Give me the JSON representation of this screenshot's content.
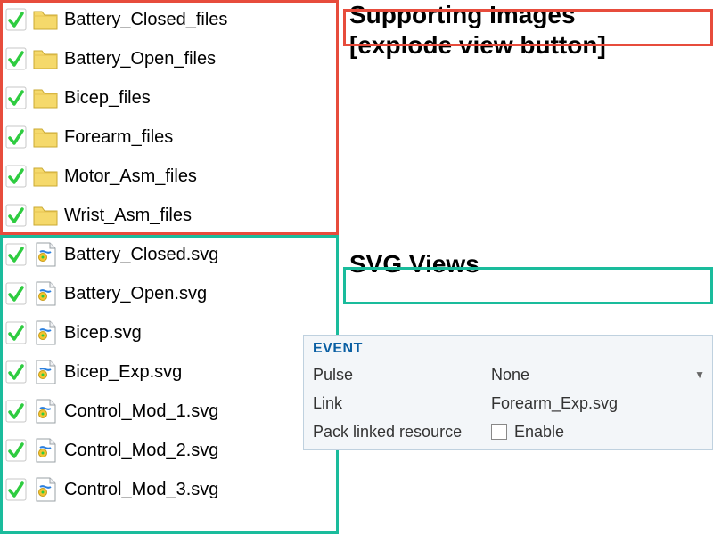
{
  "folders": [
    {
      "name": "Battery_Closed_files"
    },
    {
      "name": "Battery_Open_files"
    },
    {
      "name": "Bicep_files"
    },
    {
      "name": "Forearm_files"
    },
    {
      "name": "Motor_Asm_files"
    },
    {
      "name": "Wrist_Asm_files"
    }
  ],
  "svgs": [
    {
      "name": "Battery_Closed.svg"
    },
    {
      "name": "Battery_Open.svg"
    },
    {
      "name": "Bicep.svg"
    },
    {
      "name": "Bicep_Exp.svg"
    },
    {
      "name": "Control_Mod_1.svg"
    },
    {
      "name": "Control_Mod_2.svg"
    },
    {
      "name": "Control_Mod_3.svg"
    }
  ],
  "headings": {
    "supporting": "Supporting Images",
    "explode": "[explode view button]",
    "svg_views": "SVG Views"
  },
  "event_panel": {
    "title": "EVENT",
    "pulse_label": "Pulse",
    "pulse_value": "None",
    "link_label": "Link",
    "link_value": "Forearm_Exp.svg",
    "pack_label": "Pack linked resource",
    "pack_value": "Enable"
  }
}
